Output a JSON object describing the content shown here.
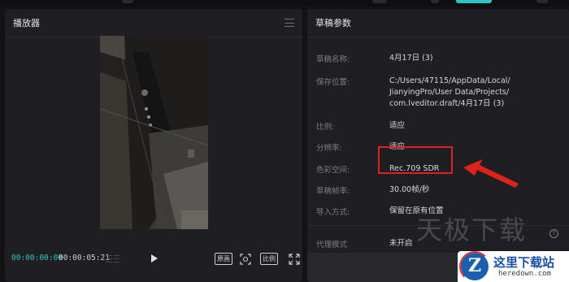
{
  "player": {
    "title": "播放器",
    "time_current": "00:00:00:00",
    "time_total": "00:00:05:21",
    "controls": {
      "original_label": "原画",
      "ratio_label": "比例"
    }
  },
  "draft": {
    "title": "草稿参数",
    "rows": [
      {
        "label": "草稿名称:",
        "value": "4月17日 (3)"
      },
      {
        "label": "保存位置:",
        "value_lines": [
          "C:/Users/47115/AppData/Local/",
          "JianyingPro/User Data/Projects/",
          "com.lveditor.draft/4月17日 (3)"
        ]
      },
      {
        "label": "比例:",
        "value": "适应"
      },
      {
        "label": "分辨率:",
        "value": "适应"
      },
      {
        "label": "色彩空间:",
        "value": "Rec.709 SDR"
      },
      {
        "label": "草稿帧率:",
        "value": "30.00帧/秒"
      },
      {
        "label": "导入方式:",
        "value": "保留在原有位置"
      },
      {
        "label": "代理模式",
        "value": "未开启"
      }
    ],
    "help_glyph": "?"
  },
  "watermark": {
    "text": "天极下载",
    "badge_title": "这里下载站",
    "badge_url": "heredown.com",
    "badge_logo_letter": "Z"
  },
  "colors": {
    "accent": "#2ec4c4",
    "highlight": "#e0221c",
    "panel": "#1f1f23",
    "background": "#131316"
  },
  "icons": [
    "menu-icon",
    "grid-icon",
    "play-icon",
    "scan-icon",
    "expand-icon",
    "help-icon",
    "arrow-annotation"
  ]
}
